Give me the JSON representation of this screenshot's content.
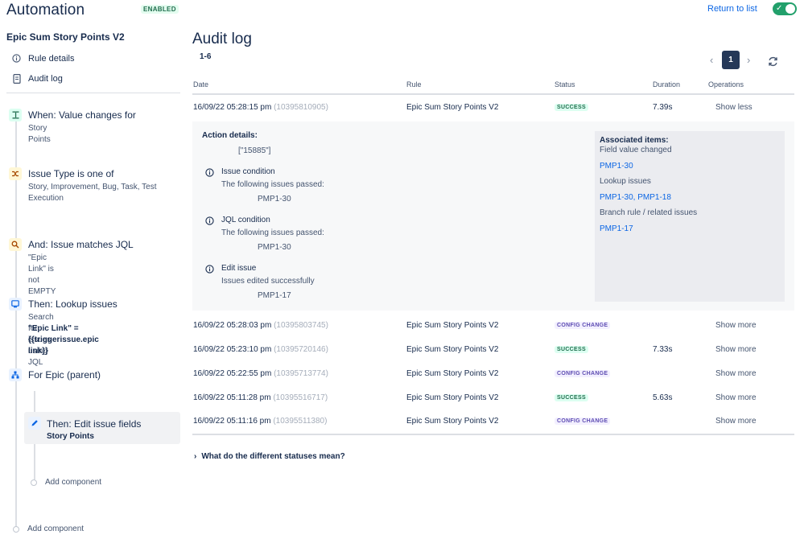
{
  "header": {
    "app_title": "Automation",
    "enabled_badge": "ENABLED",
    "return_link": "Return to list",
    "toggle_on": true
  },
  "sidebar": {
    "rule_name": "Epic Sum Story Points V2",
    "nav": [
      {
        "label": "Rule details",
        "icon": "info-icon"
      },
      {
        "label": "Audit log",
        "icon": "document-icon"
      }
    ],
    "steps": [
      {
        "title": "When: Value changes for",
        "sub": "Story Points",
        "icon": "trigger-icon"
      },
      {
        "title": "Issue Type is one of",
        "sub": "Story, Improvement, Bug, Task, Test Execution",
        "icon": "shuffle-icon"
      },
      {
        "title": "And: Issue matches JQL",
        "sub": "\"Epic Link\" is not EMPTY",
        "icon": "search-icon"
      },
      {
        "title": "Then: Lookup issues",
        "sub": "Search for issues using JQL",
        "sub_bold": "\"Epic Link\" = {{triggerissue.epic link}}",
        "icon": "lookup-icon"
      },
      {
        "title": "For Epic (parent)",
        "icon": "hierarchy-icon"
      }
    ],
    "selected_step": {
      "title": "Then: Edit issue fields",
      "sub": "Story Points",
      "icon": "pencil-icon"
    },
    "add_component": "Add component"
  },
  "main": {
    "title": "Audit log",
    "range": "1-6",
    "pager": {
      "current": "1"
    },
    "columns": [
      "Date",
      "Rule",
      "Status",
      "Duration",
      "Operations"
    ],
    "rows": [
      {
        "date": "16/09/22 05:28:15 pm",
        "id": "(10395810905)",
        "rule": "Epic Sum Story Points V2",
        "status": "SUCCESS",
        "status_type": "success",
        "duration": "7.39s",
        "op": "Show less"
      },
      {
        "date": "16/09/22 05:28:03 pm",
        "id": "(10395803745)",
        "rule": "Epic Sum Story Points V2",
        "status": "CONFIG CHANGE",
        "status_type": "config",
        "duration": "",
        "op": "Show more"
      },
      {
        "date": "16/09/22 05:23:10 pm",
        "id": "(10395720146)",
        "rule": "Epic Sum Story Points V2",
        "status": "SUCCESS",
        "status_type": "success",
        "duration": "7.33s",
        "op": "Show more"
      },
      {
        "date": "16/09/22 05:22:55 pm",
        "id": "(10395713774)",
        "rule": "Epic Sum Story Points V2",
        "status": "CONFIG CHANGE",
        "status_type": "config",
        "duration": "",
        "op": "Show more"
      },
      {
        "date": "16/09/22 05:11:28 pm",
        "id": "(10395516717)",
        "rule": "Epic Sum Story Points V2",
        "status": "SUCCESS",
        "status_type": "success",
        "duration": "5.63s",
        "op": "Show more"
      },
      {
        "date": "16/09/22 05:11:16 pm",
        "id": "(10395511380)",
        "rule": "Epic Sum Story Points V2",
        "status": "CONFIG CHANGE",
        "status_type": "config",
        "duration": "",
        "op": "Show more"
      }
    ],
    "details": {
      "header": "Action details:",
      "value": "[\"15885\"]",
      "items": [
        {
          "title": "Issue condition",
          "desc": "The following issues passed:",
          "issue": "PMP1-30"
        },
        {
          "title": "JQL condition",
          "desc": "The following issues passed:",
          "issue": "PMP1-30"
        },
        {
          "title": "Edit issue",
          "desc": "Issues edited successfully",
          "issue": "PMP1-17"
        }
      ],
      "associated": {
        "header": "Associated items:",
        "groups": [
          {
            "label": "Field value changed",
            "links": "PMP1-30"
          },
          {
            "label": "Lookup issues",
            "links": "PMP1-30, PMP1-18"
          },
          {
            "label": "Branch rule / related issues",
            "links": "PMP1-17"
          }
        ]
      }
    },
    "faq": "What do the different statuses mean?"
  },
  "colors": {
    "accent": "#0c66e4",
    "success": "#216e4e",
    "config": "#5e4db2",
    "toggle": "#22a06b"
  }
}
